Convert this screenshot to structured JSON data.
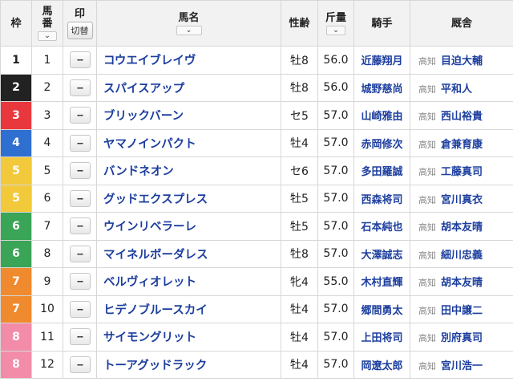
{
  "headers": {
    "waku": "枠",
    "umaban": "馬番",
    "mark": "印",
    "mark_switch": "切替",
    "horse": "馬名",
    "sexage": "性齢",
    "weight": "斤量",
    "jockey": "騎手",
    "stable": "厩舎"
  },
  "icons": {
    "sort": "chevron-down-icon",
    "mark": "dash-dash-mark"
  },
  "mark_placeholder": "--",
  "waku_colors": {
    "1": {
      "bg": "#ffffff",
      "fg": "#222222"
    },
    "2": {
      "bg": "#222222",
      "fg": "#ffffff"
    },
    "3": {
      "bg": "#e8383d",
      "fg": "#ffffff"
    },
    "4": {
      "bg": "#2f6fd0",
      "fg": "#ffffff"
    },
    "5": {
      "bg": "#f2c93b",
      "fg": "#ffffff"
    },
    "6": {
      "bg": "#3aa457",
      "fg": "#ffffff"
    },
    "7": {
      "bg": "#f08a2e",
      "fg": "#ffffff"
    },
    "8": {
      "bg": "#f28ca8",
      "fg": "#ffffff"
    }
  },
  "rows": [
    {
      "waku": "1",
      "umaban": "1",
      "horse": "コウエイブレイヴ",
      "sexage": "牡8",
      "weight": "56.0",
      "jockey": "近藤翔月",
      "region": "高知",
      "trainer": "目迫大輔"
    },
    {
      "waku": "2",
      "umaban": "2",
      "horse": "スパイスアップ",
      "sexage": "牡8",
      "weight": "56.0",
      "jockey": "城野慈尚",
      "region": "高知",
      "trainer": "平和人"
    },
    {
      "waku": "3",
      "umaban": "3",
      "horse": "ブリックバーン",
      "sexage": "セ5",
      "weight": "57.0",
      "jockey": "山崎雅由",
      "region": "高知",
      "trainer": "西山裕貴"
    },
    {
      "waku": "4",
      "umaban": "4",
      "horse": "ヤマノインパクト",
      "sexage": "牡4",
      "weight": "57.0",
      "jockey": "赤岡修次",
      "region": "高知",
      "trainer": "倉兼育康"
    },
    {
      "waku": "5",
      "umaban": "5",
      "horse": "バンドネオン",
      "sexage": "セ6",
      "weight": "57.0",
      "jockey": "多田羅誠",
      "region": "高知",
      "trainer": "工藤真司"
    },
    {
      "waku": "5",
      "umaban": "6",
      "horse": "グッドエクスプレス",
      "sexage": "牡5",
      "weight": "57.0",
      "jockey": "西森将司",
      "region": "高知",
      "trainer": "宮川真衣"
    },
    {
      "waku": "6",
      "umaban": "7",
      "horse": "ウインリベラーレ",
      "sexage": "牡5",
      "weight": "57.0",
      "jockey": "石本純也",
      "region": "高知",
      "trainer": "胡本友晴"
    },
    {
      "waku": "6",
      "umaban": "8",
      "horse": "マイネルボーダレス",
      "sexage": "牡8",
      "weight": "57.0",
      "jockey": "大澤誠志",
      "region": "高知",
      "trainer": "細川忠義"
    },
    {
      "waku": "7",
      "umaban": "9",
      "horse": "ベルヴィオレット",
      "sexage": "牝4",
      "weight": "55.0",
      "jockey": "木村直輝",
      "region": "高知",
      "trainer": "胡本友晴"
    },
    {
      "waku": "7",
      "umaban": "10",
      "horse": "ヒデノブルースカイ",
      "sexage": "牡4",
      "weight": "57.0",
      "jockey": "郷間勇太",
      "region": "高知",
      "trainer": "田中譲二"
    },
    {
      "waku": "8",
      "umaban": "11",
      "horse": "サイモングリット",
      "sexage": "牡4",
      "weight": "57.0",
      "jockey": "上田将司",
      "region": "高知",
      "trainer": "別府真司"
    },
    {
      "waku": "8",
      "umaban": "12",
      "horse": "トーアグッドラック",
      "sexage": "牡4",
      "weight": "57.0",
      "jockey": "岡遼太郎",
      "region": "高知",
      "trainer": "宮川浩一"
    }
  ]
}
